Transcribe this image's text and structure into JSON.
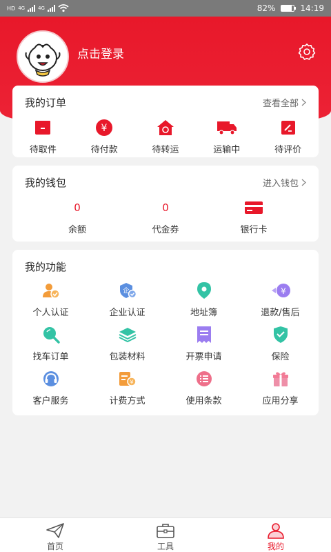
{
  "status_bar": {
    "carrier_badges": [
      "HD",
      "HD"
    ],
    "network_labels": [
      "4G",
      "4G"
    ],
    "battery_percent": "82%",
    "battery_level": 0.82,
    "time": "14:19"
  },
  "header": {
    "login_text": "点击登录"
  },
  "orders": {
    "title": "我的订单",
    "link": "查看全部",
    "items": [
      {
        "label": "待取件",
        "icon": "package-icon"
      },
      {
        "label": "待付款",
        "icon": "yuan-coin-icon"
      },
      {
        "label": "待转运",
        "icon": "transfer-house-icon"
      },
      {
        "label": "运输中",
        "icon": "truck-icon"
      },
      {
        "label": "待评价",
        "icon": "review-pen-icon"
      }
    ]
  },
  "wallet": {
    "title": "我的钱包",
    "link": "进入钱包",
    "balance": {
      "value": "0",
      "label": "余额"
    },
    "voucher": {
      "value": "0",
      "label": "代金券"
    },
    "bank_card": {
      "label": "银行卡",
      "icon": "bank-card-icon"
    }
  },
  "functions": {
    "title": "我的功能",
    "items": [
      {
        "label": "个人认证",
        "icon": "personal-verify-icon"
      },
      {
        "label": "企业认证",
        "icon": "enterprise-verify-icon"
      },
      {
        "label": "地址簿",
        "icon": "location-pin-icon"
      },
      {
        "label": "退款/售后",
        "icon": "refund-icon"
      },
      {
        "label": "找车订单",
        "icon": "search-icon"
      },
      {
        "label": "包装材料",
        "icon": "layers-icon"
      },
      {
        "label": "开票申请",
        "icon": "invoice-icon"
      },
      {
        "label": "保险",
        "icon": "shield-icon"
      },
      {
        "label": "客户服务",
        "icon": "headset-icon"
      },
      {
        "label": "计费方式",
        "icon": "billing-icon"
      },
      {
        "label": "使用条款",
        "icon": "terms-list-icon"
      },
      {
        "label": "应用分享",
        "icon": "gift-icon"
      }
    ]
  },
  "tabbar": {
    "items": [
      {
        "label": "首页",
        "icon": "paper-plane-icon"
      },
      {
        "label": "工具",
        "icon": "toolbox-icon"
      },
      {
        "label": "我的",
        "icon": "user-icon"
      }
    ]
  },
  "colors": {
    "brand_red": "#e8182a",
    "orange": "#f39c3a",
    "blue": "#5b8fe0",
    "teal": "#33c3a5",
    "purple": "#9b7df0",
    "pink": "#ee8fa8",
    "gray_text": "#666666"
  }
}
